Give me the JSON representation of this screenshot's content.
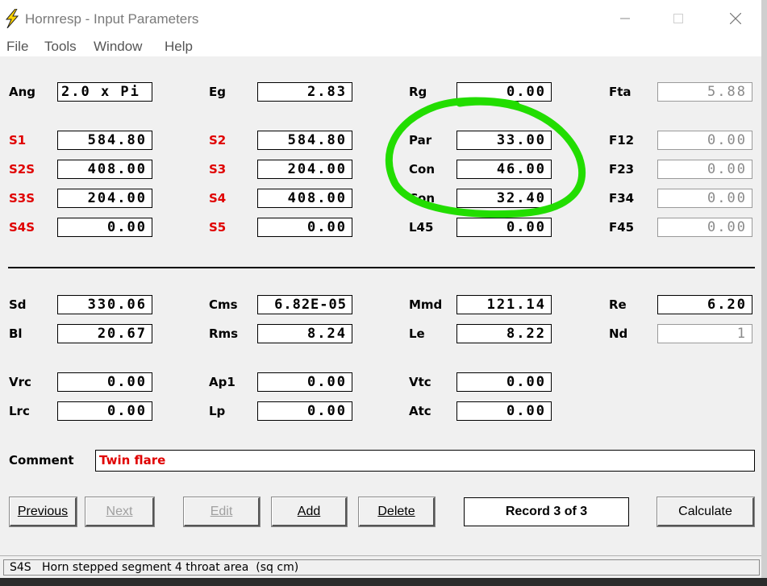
{
  "window": {
    "title": "Hornresp - Input Parameters"
  },
  "menu": [
    "File",
    "Tools",
    "Window",
    "Help"
  ],
  "colors": {
    "red_label": "#e00000",
    "annotation": "#22dd00"
  },
  "icons": {
    "app": "lightning-bolt-icon",
    "minimize": "minimize-icon",
    "maximize": "maximize-icon",
    "close": "close-icon"
  },
  "params": {
    "Ang": "2.0 x Pi",
    "Eg": "2.83",
    "Rg": "0.00",
    "Fta": "5.88",
    "S1": "584.80",
    "S2": "584.80",
    "Par": "33.00",
    "F12": "0.00",
    "S2S": "408.00",
    "S3": "204.00",
    "Con1": "46.00",
    "F23": "0.00",
    "S3S": "204.00",
    "S4": "408.00",
    "Con2": "32.40",
    "F34": "0.00",
    "S4S": "0.00",
    "S5": "0.00",
    "L45": "0.00",
    "F45": "0.00",
    "Sd": "330.06",
    "Cms": "6.82E-05",
    "Mmd": "121.14",
    "Re": "6.20",
    "Bl": "20.67",
    "Rms": "8.24",
    "Le": "8.22",
    "Nd": "1",
    "Vrc": "0.00",
    "Ap1": "0.00",
    "Vtc": "0.00",
    "Lrc": "0.00",
    "Lp": "0.00",
    "Atc": "0.00"
  },
  "labels": {
    "Ang": "Ang",
    "Eg": "Eg",
    "Rg": "Rg",
    "Fta": "Fta",
    "S1": "S1",
    "S2": "S2",
    "Par": "Par",
    "F12": "F12",
    "S2S": "S2S",
    "S3": "S3",
    "Con1": "Con",
    "F23": "F23",
    "S3S": "S3S",
    "S4": "S4",
    "Con2": "Con",
    "F34": "F34",
    "S4S": "S4S",
    "S5": "S5",
    "L45": "L45",
    "F45": "F45",
    "Sd": "Sd",
    "Cms": "Cms",
    "Mmd": "Mmd",
    "Re": "Re",
    "Bl": "Bl",
    "Rms": "Rms",
    "Le": "Le",
    "Nd": "Nd",
    "Vrc": "Vrc",
    "Ap1": "Ap1",
    "Vtc": "Vtc",
    "Lrc": "Lrc",
    "Lp": "Lp",
    "Atc": "Atc",
    "Comment": "Comment"
  },
  "comment": "Twin flare",
  "buttons": {
    "previous": "Previous",
    "next": "Next",
    "edit": "Edit",
    "add": "Add",
    "delete": "Delete",
    "calculate": "Calculate"
  },
  "record": "Record 3 of 3",
  "status": {
    "field": "S4S",
    "description": "Horn stepped segment 4 throat area  (sq cm)"
  }
}
